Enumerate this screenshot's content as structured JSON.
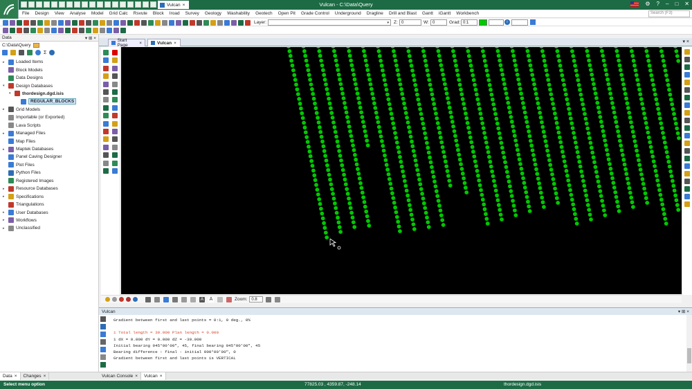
{
  "app": {
    "tab_title": "Vulcan",
    "window_title": "Vulcan - C:\\Data\\Query"
  },
  "menu": [
    "File",
    "Design",
    "View",
    "Analyse",
    "Model",
    "Grid Calc",
    "Rsvute",
    "Block",
    "Iroad",
    "Survey",
    "Geology",
    "Washability",
    "Geotech",
    "Open Pit",
    "Grade Control",
    "Underground",
    "Dragline",
    "Drill and Blast",
    "Gantt",
    "iGantt",
    "Workbench"
  ],
  "search": {
    "placeholder": "Search (F3)"
  },
  "toolbar": {
    "layer_label": "Layer:",
    "layer_value": "",
    "z_label": "Z:",
    "z_value": "0",
    "w_label": "W:",
    "w_value": "0",
    "grad_label": "Grad:",
    "grad_value": "0:1"
  },
  "data_panel": {
    "title": "Data",
    "path": "C:\\Data\\Query",
    "tree": [
      {
        "label": "Loaded Items",
        "level": 0,
        "expander": "▸",
        "icon": "folder-icon",
        "color": "#3a7bd5"
      },
      {
        "label": "Block Models",
        "level": 0,
        "expander": "",
        "icon": "block-model-icon",
        "color": "#7b5ea7"
      },
      {
        "label": "Data Designs",
        "level": 0,
        "expander": "",
        "icon": "design-icon",
        "color": "#2e8b57"
      },
      {
        "label": "Design Databases",
        "level": 0,
        "expander": "▾",
        "icon": "database-icon",
        "color": "#c0392b"
      },
      {
        "label": "thordesign.dgd.isis",
        "level": 1,
        "expander": "▾",
        "icon": "isis-file-icon",
        "color": "#c0392b",
        "bold": true
      },
      {
        "label": "REGULAR_BLOCKS",
        "level": 2,
        "expander": "",
        "icon": "layer-icon",
        "color": "#3a7bd5",
        "selected": true
      },
      {
        "label": "Grid Models",
        "level": 0,
        "expander": "▸",
        "icon": "grid-icon",
        "color": "#555"
      },
      {
        "label": "Importable (or Exported)",
        "level": 0,
        "expander": "",
        "icon": "import-icon",
        "color": "#888"
      },
      {
        "label": "Lava Scripts",
        "level": 0,
        "expander": "",
        "icon": "script-icon",
        "color": "#888"
      },
      {
        "label": "Managed Files",
        "level": 0,
        "expander": "▸",
        "icon": "folder-icon",
        "color": "#3a7bd5"
      },
      {
        "label": "Map Files",
        "level": 0,
        "expander": "",
        "icon": "map-icon",
        "color": "#3a7bd5"
      },
      {
        "label": "Maptek Databases",
        "level": 0,
        "expander": "▸",
        "icon": "database-icon",
        "color": "#7b5ea7"
      },
      {
        "label": "Panel Caving Designer",
        "level": 0,
        "expander": "",
        "icon": "panel-icon",
        "color": "#3a7bd5"
      },
      {
        "label": "Plot Files",
        "level": 0,
        "expander": "",
        "icon": "plot-icon",
        "color": "#3a7bd5"
      },
      {
        "label": "Python Files",
        "level": 0,
        "expander": "",
        "icon": "python-icon",
        "color": "#2d6db5"
      },
      {
        "label": "Registered Images",
        "level": 0,
        "expander": "",
        "icon": "image-icon",
        "color": "#2e8b57"
      },
      {
        "label": "Resource Databases",
        "level": 0,
        "expander": "▸",
        "icon": "database-icon",
        "color": "#c0392b"
      },
      {
        "label": "Specifications",
        "level": 0,
        "expander": "▸",
        "icon": "spec-icon",
        "color": "#d4a017"
      },
      {
        "label": "Triangulations",
        "level": 0,
        "expander": "",
        "icon": "triangle-icon",
        "color": "#c0392b"
      },
      {
        "label": "User Databases",
        "level": 0,
        "expander": "▸",
        "icon": "database-icon",
        "color": "#3a7bd5"
      },
      {
        "label": "Workflows",
        "level": 0,
        "expander": "▸",
        "icon": "workflow-icon",
        "color": "#7b5ea7"
      },
      {
        "label": "Unclassified",
        "level": 0,
        "expander": "▸",
        "icon": "file-icon",
        "color": "#888"
      }
    ],
    "tabs": [
      "Data",
      "Changes"
    ]
  },
  "doc_tabs": [
    "Start Page",
    "Vulcan"
  ],
  "viewer": {
    "zoom_label": "Zoom:",
    "zoom_value": "0.8",
    "point_color": "#00c800"
  },
  "console": {
    "title": "Vulcan",
    "lines": [
      {
        "text": "Gradient between first and last points = 0:1, 0 deg., 0%",
        "color": "#222"
      },
      {
        "text": "",
        "color": "#222"
      },
      {
        "text": "1 Total length = 30.000 Plan length = 0.000",
        "color": "#d9462b"
      },
      {
        "text": "1 dX = 0.000 dY = 0.000 dZ = -30.000",
        "color": "#222"
      },
      {
        "text": "Initial bearing 045°00'00\", 45, final bearing 045°00'00\", 45",
        "color": "#222"
      },
      {
        "text": "Bearing difference : final - initial 000°00'00\", 0",
        "color": "#222"
      },
      {
        "text": "Gradient between first and last points is VERTICAL",
        "color": "#222"
      }
    ],
    "tabs": [
      "Vulcan Console",
      "Vulcan"
    ]
  },
  "status": {
    "left": "Select menu option",
    "coords": "77825.03 , 4359.87, -248.14",
    "file": "thordesign.dgd.isis"
  }
}
